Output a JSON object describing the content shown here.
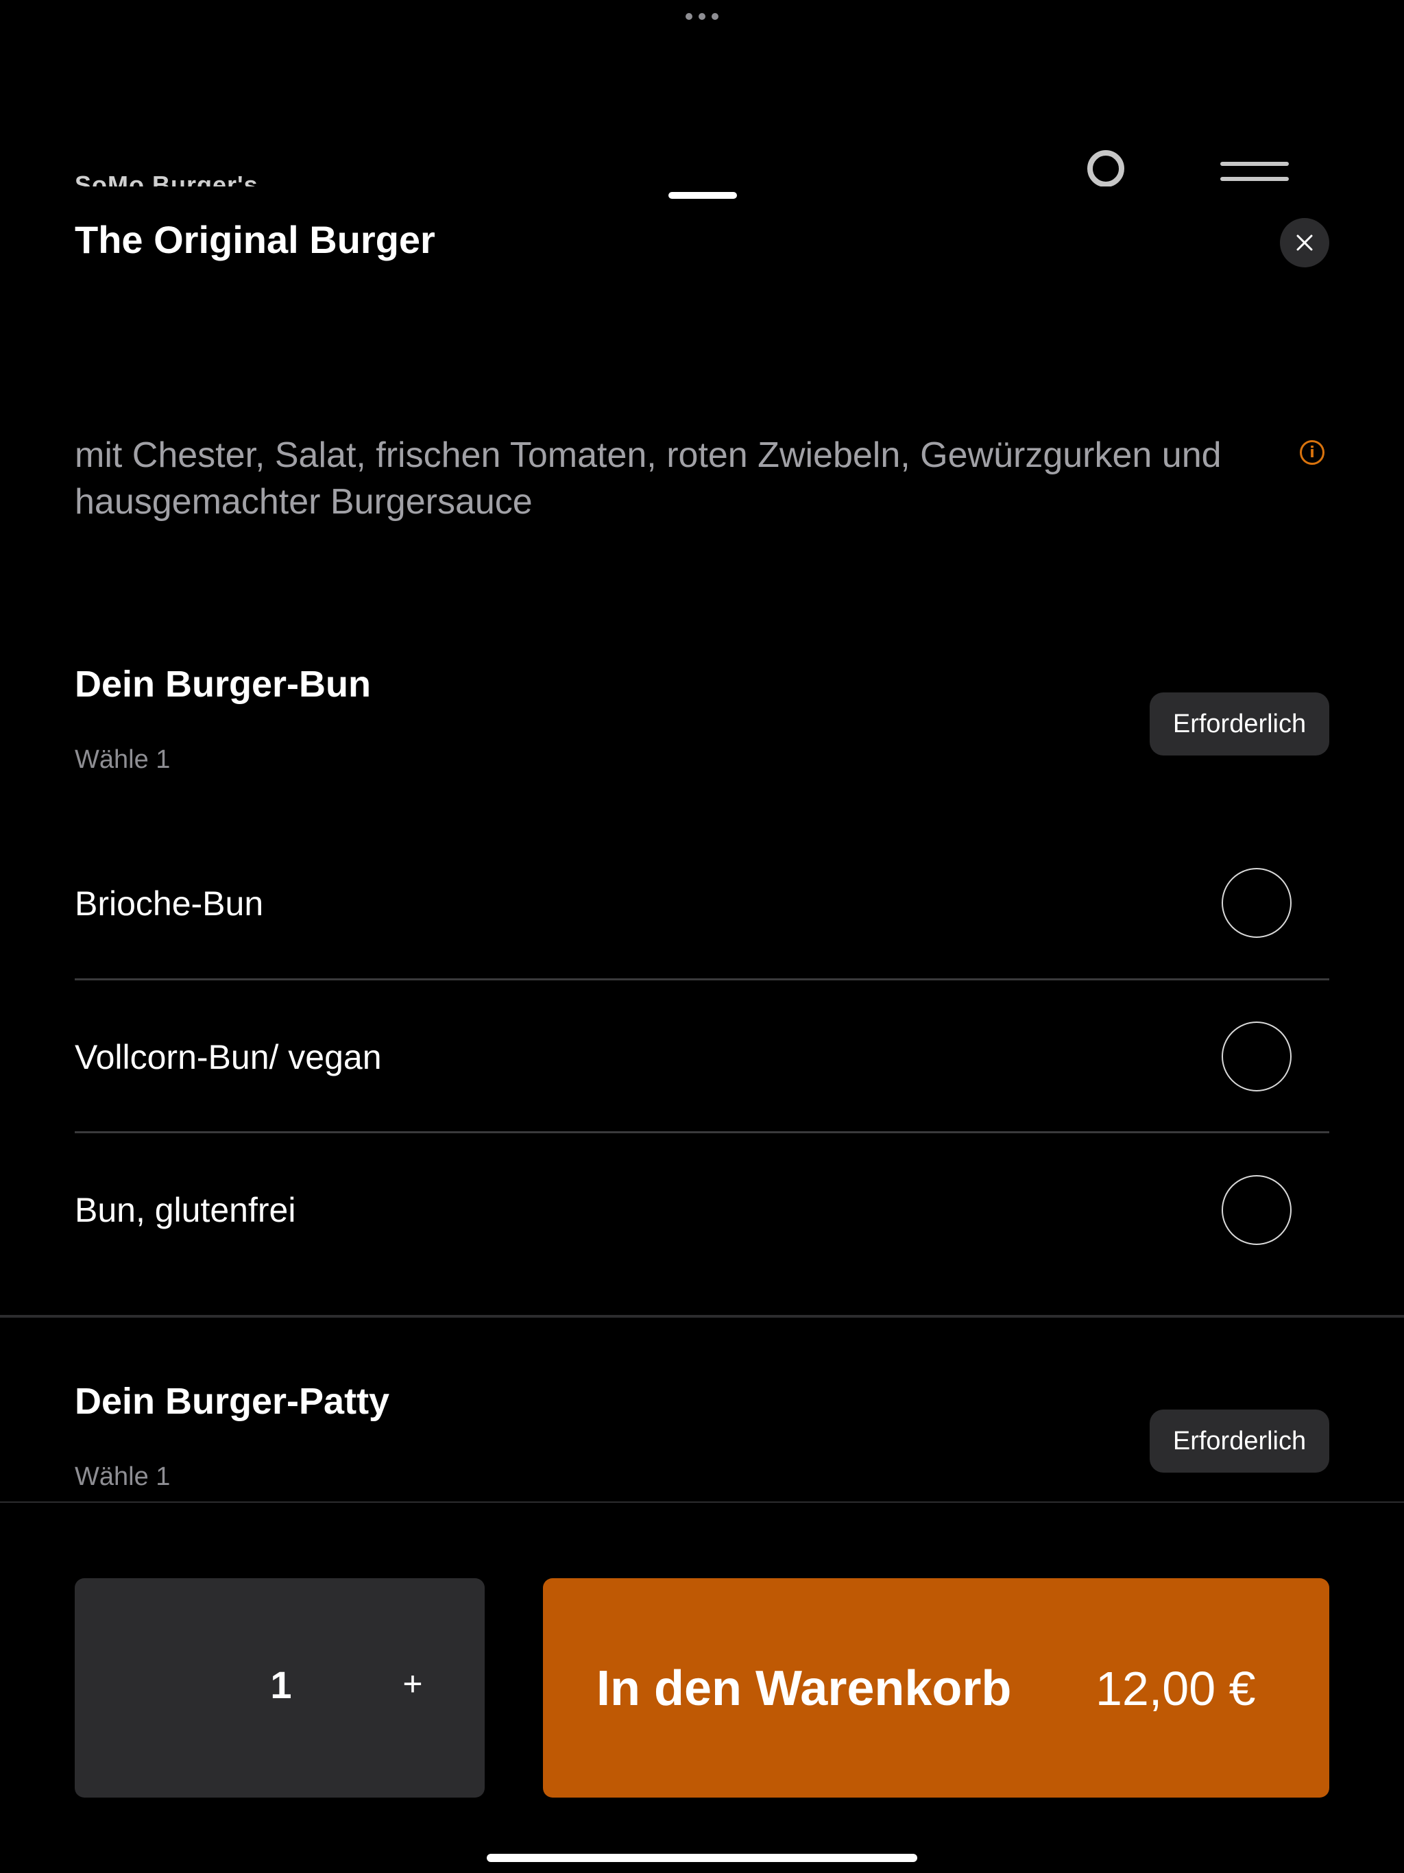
{
  "background_header": {
    "brand": "SoMo Burger's"
  },
  "product": {
    "title": "The Original Burger",
    "description": "mit Chester, Salat, frischen Tomaten, roten Zwiebeln, Gewürzgurken und hausgemachter Burgersauce"
  },
  "sections": [
    {
      "title": "Dein Burger-Bun",
      "subtitle": "Wähle 1",
      "badge": "Erforderlich",
      "options": [
        {
          "label": "Brioche-Bun",
          "selected": false
        },
        {
          "label": "Vollcorn-Bun/ vegan",
          "selected": false
        },
        {
          "label": "Bun, glutenfrei",
          "selected": false
        }
      ]
    },
    {
      "title": "Dein Burger-Patty",
      "subtitle": "Wähle 1",
      "badge": "Erforderlich"
    }
  ],
  "cart": {
    "quantity": "1",
    "plus": "+",
    "add_label": "In den Warenkorb",
    "price": "12,00 €"
  },
  "colors": {
    "accent": "#bf5904",
    "info": "#d9730d",
    "surface": "#2c2c2e",
    "background": "#000000"
  },
  "icons": {
    "close": "close-icon",
    "info": "info-icon",
    "more": "more-dots-icon",
    "account": "account-ring-icon",
    "menu": "menu-icon"
  }
}
